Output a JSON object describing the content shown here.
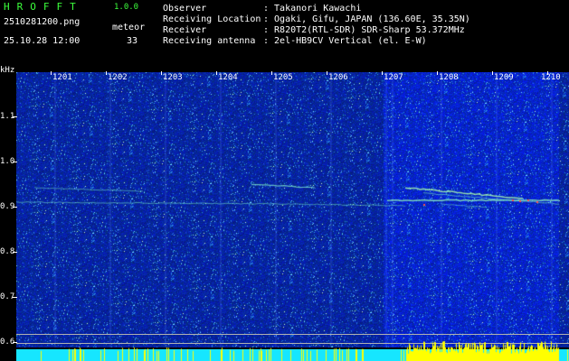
{
  "header": {
    "app_title": "HROFFT",
    "app_version": "1.0.0",
    "file_name": "2510281200.png",
    "datetime": "25.10.28 12:00",
    "meteor_label": "meteor",
    "meteor_count": "33"
  },
  "info": {
    "observer_label": "Observer",
    "observer_value": ": Takanori Kawachi",
    "location_label": "Receiving Location",
    "location_value": ": Ogaki, Gifu, JAPAN (136.60E, 35.35N)",
    "receiver_label": "Receiver",
    "receiver_value": ": R820T2(RTL-SDR) SDR-Sharp 53.372MHz",
    "antenna_label": "Receiving antenna",
    "antenna_value": ": 2el-HB9CV Vertical (el. E-W)"
  },
  "axes": {
    "y_unit": "kHz",
    "y_ticks": [
      "1.1",
      "1.0",
      "0.9",
      "0.8",
      "0.7",
      "0.6"
    ],
    "x_ticks": [
      "1201",
      "1202",
      "1203",
      "1204",
      "1205",
      "1206",
      "1207",
      "1208",
      "1209",
      "1210"
    ]
  },
  "colors": {
    "background": "#000000",
    "spectrogram_bg": "#0a1a8c",
    "header_green": "#3cff3c",
    "signal_cyan": "#16e6ff",
    "signal_yellow": "#ffff00"
  }
}
